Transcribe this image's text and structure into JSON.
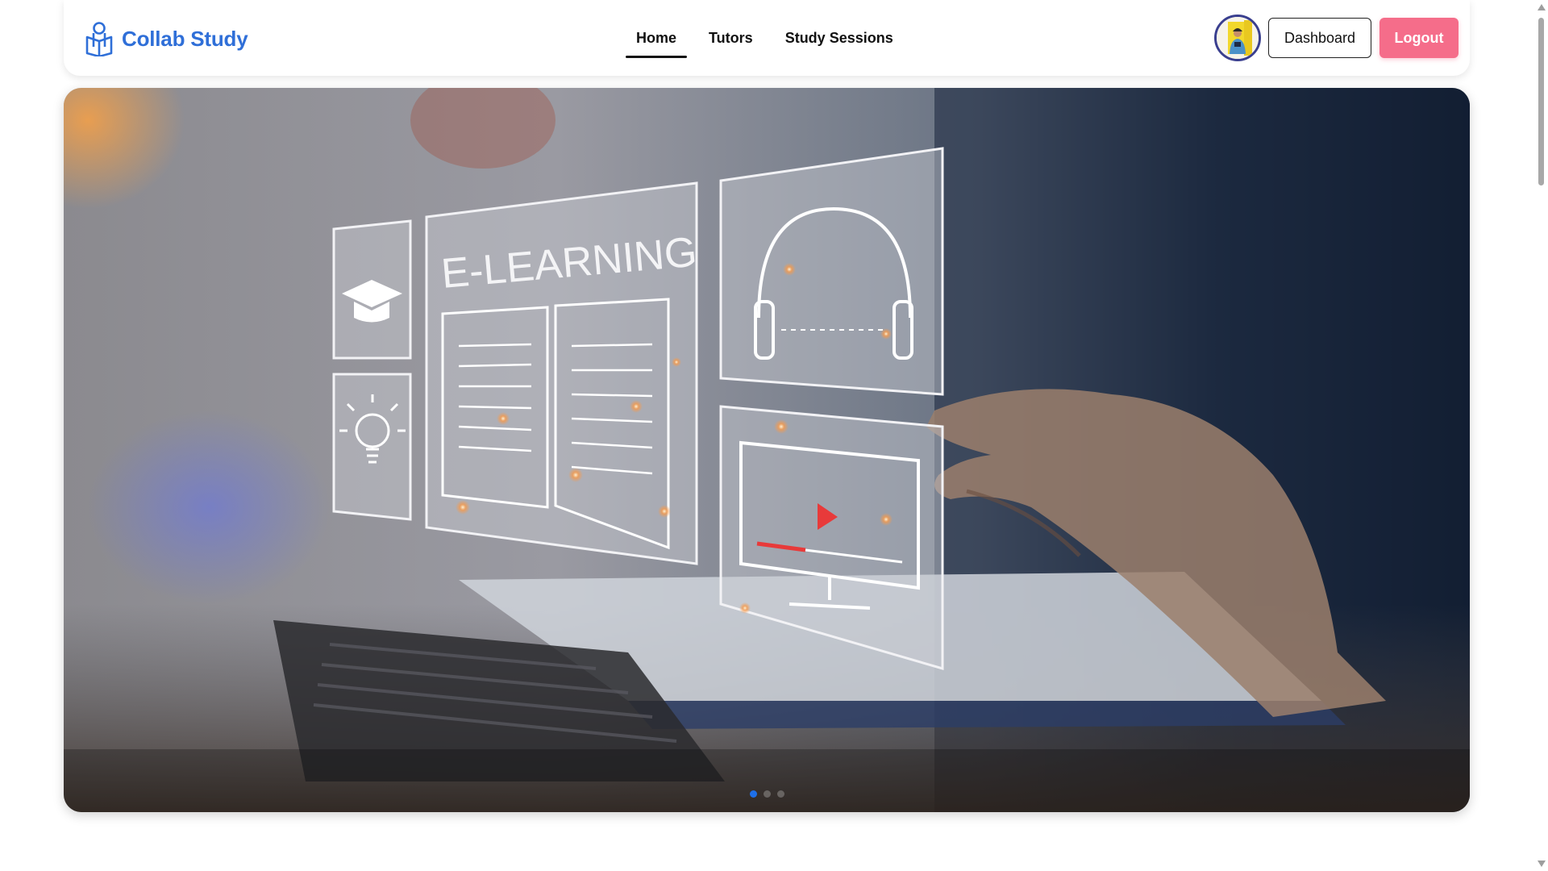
{
  "brand": {
    "name": "Collab Study",
    "icon": "book-person-icon",
    "color": "#2f6fd8"
  },
  "nav": {
    "items": [
      {
        "label": "Home",
        "active": true
      },
      {
        "label": "Tutors",
        "active": false
      },
      {
        "label": "Study Sessions",
        "active": false
      }
    ]
  },
  "user": {
    "avatar": "user-avatar-photo"
  },
  "actions": {
    "dashboard_label": "Dashboard",
    "logout_label": "Logout",
    "logout_color": "#f56d8a"
  },
  "hero": {
    "image": "e-learning-banner",
    "image_text": "E-LEARNING",
    "slide_count": 3,
    "active_slide": 1,
    "indicator_color": "#1e6fe8"
  }
}
